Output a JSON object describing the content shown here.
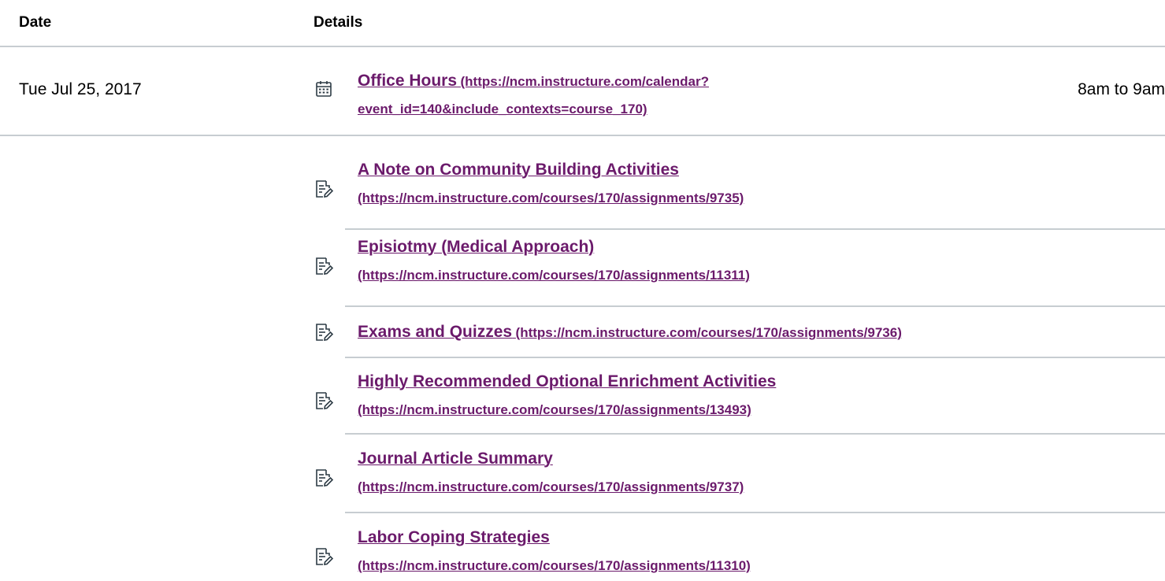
{
  "table": {
    "header_date": "Date",
    "header_details": "Details"
  },
  "event": {
    "date": "Tue Jul 25, 2017",
    "title": "Office Hours",
    "url_line1": "(https://ncm.instructure.com/calendar?",
    "url_line2": "event_id=140&include_contexts=course_170)",
    "time": "8am to 9am",
    "icon": "calendar-icon"
  },
  "assignments": [
    {
      "title": "A Note on Community Building Activities",
      "url": "(https://ncm.instructure.com/courses/170/assignments/9735)",
      "icon": "assignment-icon"
    },
    {
      "title": "Episiotmy (Medical Approach)",
      "url": "(https://ncm.instructure.com/courses/170/assignments/11311)",
      "icon": "assignment-icon"
    },
    {
      "title": "Exams and Quizzes",
      "url": "(https://ncm.instructure.com/courses/170/assignments/9736)",
      "icon": "assignment-icon"
    },
    {
      "title": "Highly Recommended Optional Enrichment Activities",
      "url": "(https://ncm.instructure.com/courses/170/assignments/13493)",
      "icon": "assignment-icon"
    },
    {
      "title": "Journal Article Summary",
      "url": "(https://ncm.instructure.com/courses/170/assignments/9737)",
      "icon": "assignment-icon"
    },
    {
      "title": "Labor Coping Strategies",
      "url": "(https://ncm.instructure.com/courses/170/assignments/11310)",
      "icon": "assignment-icon"
    }
  ],
  "colors": {
    "link": "#6b1a6b",
    "divider": "#c7cdd1",
    "text": "#000000"
  }
}
